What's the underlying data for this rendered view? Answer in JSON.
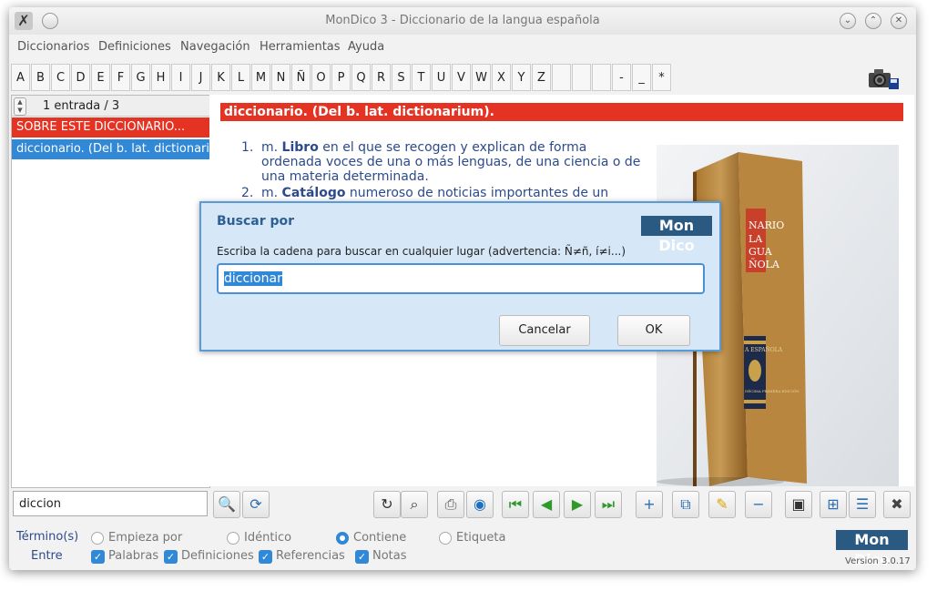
{
  "window": {
    "title": "MonDico 3 - Diccionario de la langua española"
  },
  "menu": [
    "Diccionarios",
    "Definiciones",
    "Navegación",
    "Herramientas",
    "Ayuda"
  ],
  "letters": [
    "A",
    "B",
    "C",
    "D",
    "E",
    "F",
    "G",
    "H",
    "I",
    "J",
    "K",
    "L",
    "M",
    "N",
    "Ñ",
    "O",
    "P",
    "Q",
    "R",
    "S",
    "T",
    "U",
    "V",
    "W",
    "X",
    "Y",
    "Z",
    "",
    "",
    "",
    "-",
    "_",
    "*"
  ],
  "left": {
    "counter": "1 entrada / 3",
    "rows": [
      "SOBRE ESTE DICCIONARIO...",
      "diccionario. (Del b. lat. dictionariu..."
    ]
  },
  "entry": {
    "heading": "diccionario. (Del b. lat. dictionarium).",
    "defs": [
      {
        "num": "1.",
        "pre": "m. ",
        "bold": "Libro",
        "rest": " en el que se recogen y explican de forma ordenada voces de una o más lenguas, de una ciencia o de una materia determinada."
      },
      {
        "num": "2.",
        "pre": "m. ",
        "bold": "Catálogo",
        "rest": " numeroso de noticias importantes de un"
      }
    ],
    "book_spine": [
      "NARIO",
      "LA",
      "GUA",
      "ÑOLA",
      "A ESPAÑOLA",
      "DÉCIMA PRIMERA EDICIÓN"
    ]
  },
  "search": {
    "value": "diccion"
  },
  "options": {
    "term_label": "Término(s)",
    "between_label": "Entre",
    "radios": [
      {
        "label": "Empieza por",
        "checked": false
      },
      {
        "label": "Idéntico",
        "checked": false
      },
      {
        "label": "Contiene",
        "checked": true
      },
      {
        "label": "Etiqueta",
        "checked": false
      }
    ],
    "checks": [
      "Palabras",
      "Definiciones",
      "Referencias",
      "Notas"
    ]
  },
  "brand": {
    "logo": "Mon Dico",
    "version": "Version 3.0.17"
  },
  "dialog": {
    "title": "Buscar por",
    "logo": "Mon Dico",
    "prompt": "Escriba la cadena para buscar en cualquier lugar (advertencia: Ñ≠ñ, í≠i...)",
    "value": "diccionar",
    "cancel": "Cancelar",
    "ok": "OK"
  },
  "colors": {
    "accent_red": "#e53323",
    "accent_blue": "#3188d6",
    "brand_blue": "#2a5a82"
  }
}
